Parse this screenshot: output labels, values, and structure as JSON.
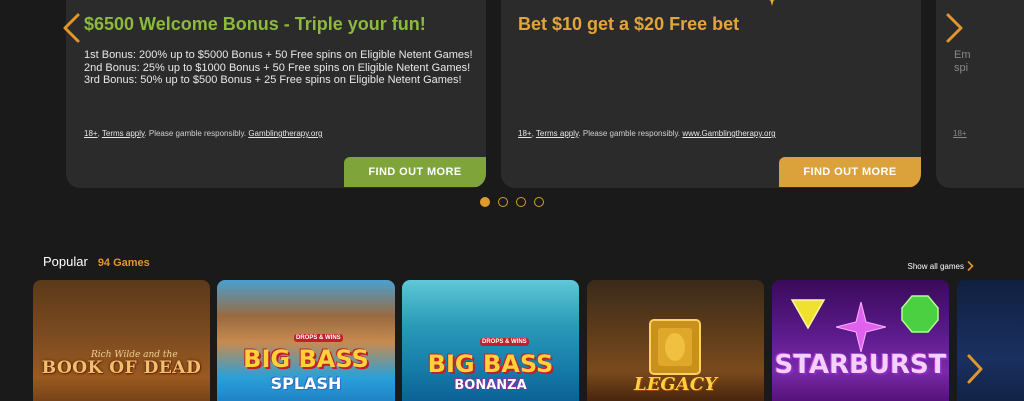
{
  "carousel": {
    "cards": [
      {
        "title": "$6500 Welcome Bonus - Triple your fun!",
        "body": [
          "1st Bonus: 200% up to $5000 Bonus + 50 Free spins on Eligible Netent Games!",
          "2nd Bonus: 25% up to $1000 Bonus + 50 Free spins on Eligible Netent Games!",
          "3rd Bonus: 50% up to $500 Bonus + 25 Free spins on Eligible Netent Games!"
        ],
        "terms": {
          "age": "18+",
          "terms_link": "Terms apply",
          "note": ". Please gamble responsibly. ",
          "site": "Gamblingtherapy.org"
        },
        "cta": "FIND OUT MORE",
        "accent": "#8cba3c"
      },
      {
        "title": "Bet $10 get a $20 Free bet",
        "terms": {
          "age": "18+",
          "terms_link": "Terms apply",
          "note": ". Please gamble responsibly. ",
          "site": "www.Gamblingtherapy.org"
        },
        "cta": "FIND OUT MORE",
        "accent": "#e3a53a"
      },
      {
        "peek_line1": "Em",
        "peek_line2": "spi",
        "peek_terms": "18+"
      }
    ],
    "dots": [
      true,
      false,
      false,
      false
    ],
    "dot_color": "#e09a2c"
  },
  "popular": {
    "title": "Popular",
    "count": "94 Games",
    "show_all": "Show all games"
  },
  "games": [
    {
      "name": "Book of Dead",
      "title": "BOOK OF DEAD",
      "subtitle": "Rich Wilde and the"
    },
    {
      "name": "Big Bass Splash",
      "title": "BIG BASS",
      "subtitle": "SPLASH",
      "badge": "DROPS & WINS"
    },
    {
      "name": "Big Bass Bonanza",
      "title": "BIG BASS",
      "subtitle": "BONANZA",
      "badge": "DROPS & WINS"
    },
    {
      "name": "Legacy of Dead",
      "title": "LEGACY"
    },
    {
      "name": "Starburst",
      "title": "STARBURST"
    },
    {
      "name": "partial game tile"
    }
  ]
}
